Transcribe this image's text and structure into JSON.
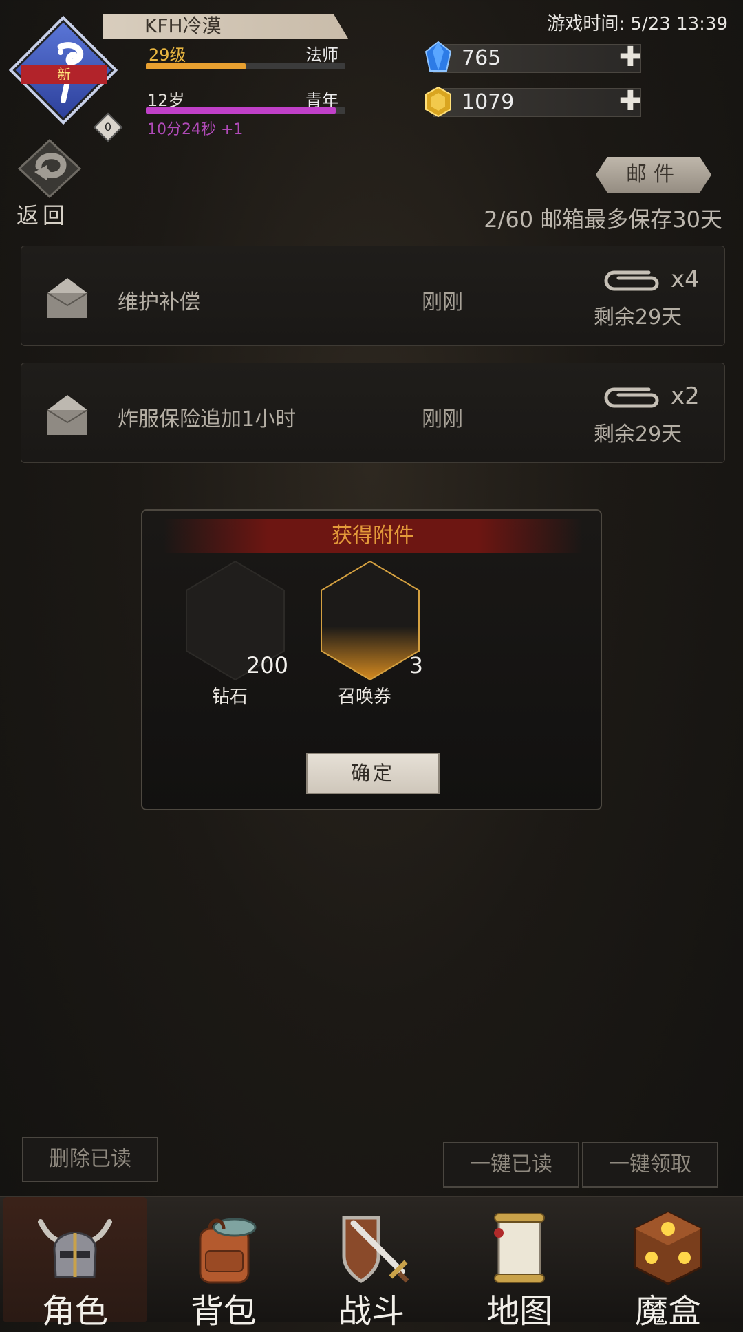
{
  "status": {
    "game_time": "游戏时间: 5/23 13:39"
  },
  "player": {
    "name": "KFH冷漠",
    "level": "29级",
    "class": "法师",
    "level_progress": 0.5,
    "age": "12岁",
    "life_stage": "青年",
    "age_progress": 0.95,
    "timer": "10分24秒 +1",
    "avatar_badge_new": "新",
    "avatar_badge_count": "0",
    "avatar_icon": "magic-staff-icon"
  },
  "currency": {
    "diamond": "765",
    "gold": "1079",
    "add_icon": "plus-icon"
  },
  "nav_back": {
    "label": "返回"
  },
  "mailbox": {
    "tab_label": "邮件",
    "count_info": "2/60 邮箱最多保存30天",
    "items": [
      {
        "title": "维护补偿",
        "time": "刚刚",
        "attachments": "x4",
        "remaining": "剩余29天"
      },
      {
        "title": "炸服保险追加1小时",
        "time": "刚刚",
        "attachments": "x2",
        "remaining": "剩余29天"
      }
    ]
  },
  "popup": {
    "title": "获得附件",
    "rewards": [
      {
        "name": "钻石",
        "qty": "200"
      },
      {
        "name": "召唤券",
        "qty": "3"
      }
    ],
    "confirm": "确定"
  },
  "actions": {
    "delete_read": "删除已读",
    "mark_all_read": "一键已读",
    "claim_all": "一键领取"
  },
  "tabs": [
    {
      "label": "角色",
      "icon": "helmet-icon"
    },
    {
      "label": "背包",
      "icon": "backpack-icon"
    },
    {
      "label": "战斗",
      "icon": "sword-shield-icon"
    },
    {
      "label": "地图",
      "icon": "scroll-map-icon"
    },
    {
      "label": "魔盒",
      "icon": "magic-box-icon"
    }
  ],
  "colors": {
    "level_bar": "#e8a030",
    "age_bar": "#c040c8",
    "popup_title": "#e39a3a",
    "timer_text": "#b04ab8"
  }
}
